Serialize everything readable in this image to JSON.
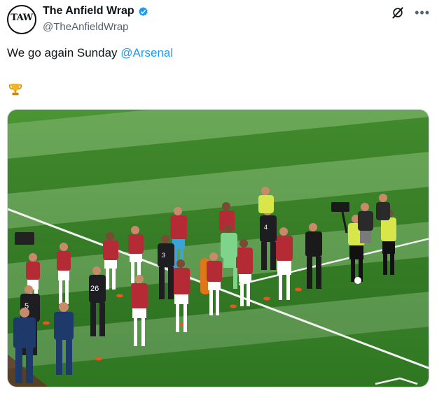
{
  "account": {
    "display_name": "The Anfield Wrap",
    "handle": "@TheAnfieldWrap",
    "avatar_letters": "TAW",
    "avatar_caption": "THE ANFIELD WRAP"
  },
  "tweet": {
    "text": "We go again Sunday ",
    "mention": "@Arsenal",
    "emoji": "trophy"
  },
  "photo": {
    "shirt_numbers": [
      "26",
      "5",
      "3",
      "4"
    ],
    "pitch_color": "#3f8a2c"
  },
  "colors": {
    "link": "#1d9bf0",
    "verified": "#1d9bf0",
    "secondary_text": "#536471"
  },
  "icons": [
    "verified-badge-icon",
    "grok-icon",
    "more-options-icon",
    "trophy-icon"
  ]
}
